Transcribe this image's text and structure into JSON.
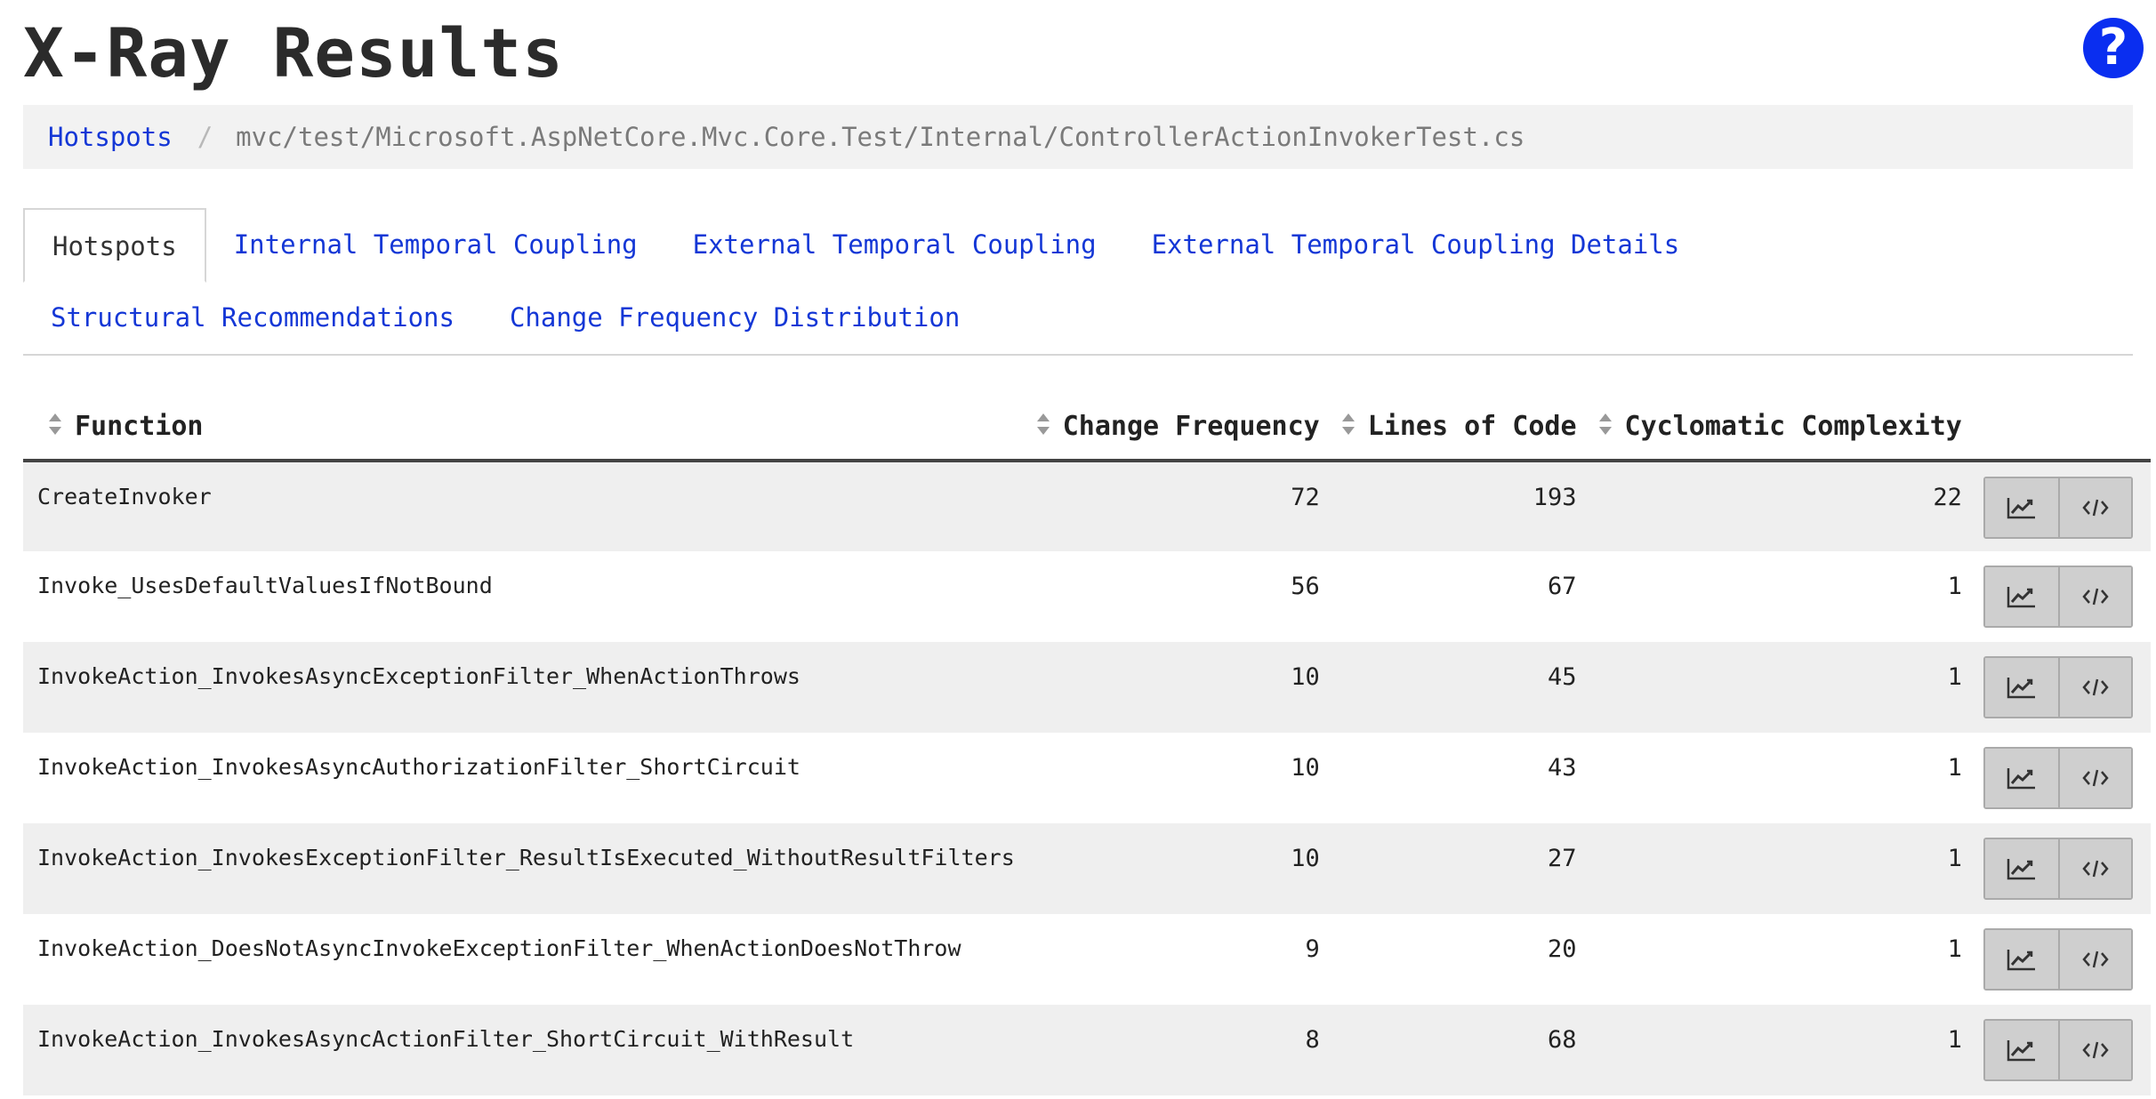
{
  "page": {
    "title": "X-Ray Results",
    "help_icon": "question-circle-icon",
    "help_glyph": "?"
  },
  "breadcrumb": {
    "root_label": "Hotspots",
    "separator": "/",
    "current_path": "mvc/test/Microsoft.AspNetCore.Mvc.Core.Test/Internal/ControllerActionInvokerTest.cs"
  },
  "tabs": [
    {
      "label": "Hotspots",
      "active": true
    },
    {
      "label": "Internal Temporal Coupling",
      "active": false
    },
    {
      "label": "External Temporal Coupling",
      "active": false
    },
    {
      "label": "External Temporal Coupling Details",
      "active": false
    },
    {
      "label": "Structural Recommendations",
      "active": false
    },
    {
      "label": "Change Frequency Distribution",
      "active": false
    }
  ],
  "table": {
    "columns": {
      "function": "Function",
      "change_frequency": "Change Frequency",
      "lines_of_code": "Lines of Code",
      "cyclomatic_complexity": "Cyclomatic Complexity"
    },
    "rows": [
      {
        "function": "CreateInvoker",
        "change_frequency": "72",
        "lines_of_code": "193",
        "cyclomatic_complexity": "22"
      },
      {
        "function": "Invoke_UsesDefaultValuesIfNotBound",
        "change_frequency": "56",
        "lines_of_code": "67",
        "cyclomatic_complexity": "1"
      },
      {
        "function": "InvokeAction_InvokesAsyncExceptionFilter_WhenActionThrows",
        "change_frequency": "10",
        "lines_of_code": "45",
        "cyclomatic_complexity": "1"
      },
      {
        "function": "InvokeAction_InvokesAsyncAuthorizationFilter_ShortCircuit",
        "change_frequency": "10",
        "lines_of_code": "43",
        "cyclomatic_complexity": "1"
      },
      {
        "function": "InvokeAction_InvokesExceptionFilter_ResultIsExecuted_WithoutResultFilters",
        "change_frequency": "10",
        "lines_of_code": "27",
        "cyclomatic_complexity": "1"
      },
      {
        "function": "InvokeAction_DoesNotAsyncInvokeExceptionFilter_WhenActionDoesNotThrow",
        "change_frequency": "9",
        "lines_of_code": "20",
        "cyclomatic_complexity": "1"
      },
      {
        "function": "InvokeAction_InvokesAsyncActionFilter_ShortCircuit_WithResult",
        "change_frequency": "8",
        "lines_of_code": "68",
        "cyclomatic_complexity": "1"
      }
    ],
    "row_actions": {
      "trend_icon": "line-chart-icon",
      "code_icon": "code-icon"
    }
  },
  "colors": {
    "link": "#1437d6",
    "help_button": "#0a2ef0",
    "breadcrumb_bg": "#f2f2f2",
    "row_stripe": "#efefef",
    "action_button_bg": "#cfcfcf"
  }
}
